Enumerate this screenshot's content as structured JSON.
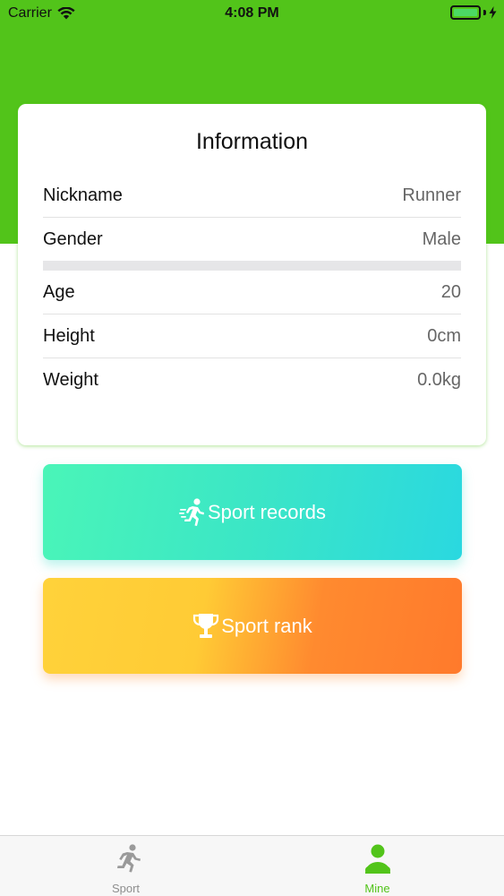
{
  "status_bar": {
    "carrier": "Carrier",
    "time": "4:08 PM"
  },
  "colors": {
    "header_green": "#52c41a",
    "records_gradient": [
      "#4af5b8",
      "#2ad8e0"
    ],
    "rank_gradient": [
      "#ffd23a",
      "#ff7a2c"
    ],
    "tab_active": "#52c41a",
    "tab_inactive": "#8e8e8e"
  },
  "info_card": {
    "title": "Information",
    "rows": [
      {
        "label": "Nickname",
        "value": "Runner"
      },
      {
        "label": "Gender",
        "value": "Male"
      },
      {
        "label": "Age",
        "value": "20"
      },
      {
        "label": "Height",
        "value": "0cm"
      },
      {
        "label": "Weight",
        "value": "0.0kg"
      }
    ]
  },
  "buttons": {
    "records": {
      "label": "Sport records",
      "icon": "running-man-icon"
    },
    "rank": {
      "label": "Sport rank",
      "icon": "trophy-icon"
    }
  },
  "tab_bar": {
    "tabs": [
      {
        "label": "Sport",
        "icon": "running-man-icon",
        "active": false
      },
      {
        "label": "Mine",
        "icon": "user-icon",
        "active": true
      }
    ]
  }
}
